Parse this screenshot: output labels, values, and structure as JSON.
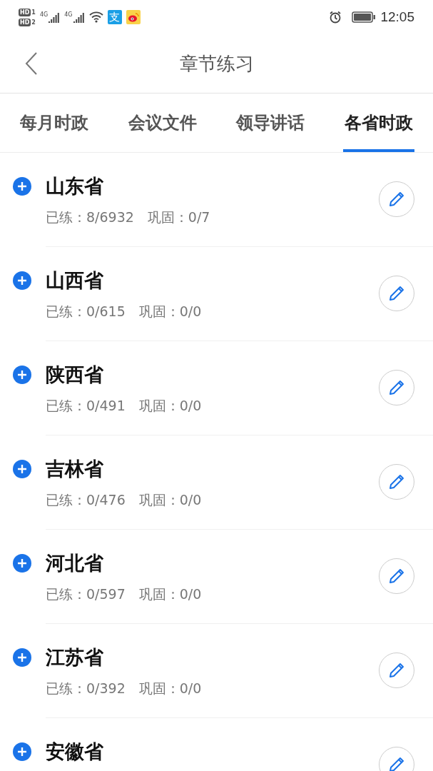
{
  "status_bar": {
    "sims": [
      {
        "label": "HD",
        "slot": "1"
      },
      {
        "label": "HD",
        "slot": "2"
      }
    ],
    "networks": [
      {
        "label": "4G"
      },
      {
        "label": "4G"
      }
    ],
    "apps": [
      {
        "kind": "alipay",
        "glyph": "支"
      },
      {
        "kind": "weibo"
      }
    ],
    "time": "12:05"
  },
  "header": {
    "title": "章节练习"
  },
  "tabs": [
    {
      "label": "每月时政",
      "selected": false
    },
    {
      "label": "会议文件",
      "selected": false
    },
    {
      "label": "领导讲话",
      "selected": false
    },
    {
      "label": "各省时政",
      "selected": true
    }
  ],
  "chapters": [
    {
      "name": "山东省",
      "practiced_label": "已练：",
      "practiced": "8/6932",
      "review_label": "巩固：",
      "review": "0/7"
    },
    {
      "name": "山西省",
      "practiced_label": "已练：",
      "practiced": "0/615",
      "review_label": "巩固：",
      "review": "0/0"
    },
    {
      "name": "陕西省",
      "practiced_label": "已练：",
      "practiced": "0/491",
      "review_label": "巩固：",
      "review": "0/0"
    },
    {
      "name": "吉林省",
      "practiced_label": "已练：",
      "practiced": "0/476",
      "review_label": "巩固：",
      "review": "0/0"
    },
    {
      "name": "河北省",
      "practiced_label": "已练：",
      "practiced": "0/597",
      "review_label": "巩固：",
      "review": "0/0"
    },
    {
      "name": "江苏省",
      "practiced_label": "已练：",
      "practiced": "0/392",
      "review_label": "巩固：",
      "review": "0/0"
    },
    {
      "name": "安徽省"
    }
  ]
}
